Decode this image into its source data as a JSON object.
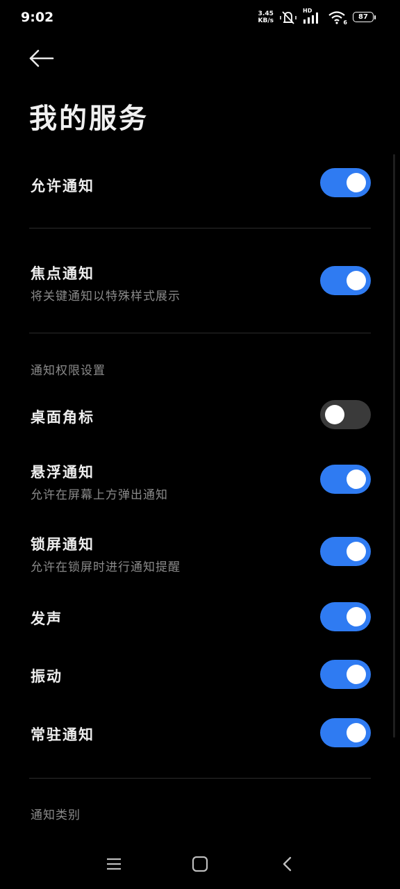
{
  "status_bar": {
    "time": "9:02",
    "net_speed_value": "3.45",
    "net_speed_unit": "KB/s",
    "network_type": "HD",
    "wifi_level": "6",
    "battery_level": "87"
  },
  "header": {
    "title": "我的服务"
  },
  "settings": {
    "allow_notifications": {
      "title": "允许通知",
      "enabled": true
    },
    "focus_notifications": {
      "title": "焦点通知",
      "subtitle": "将关键通知以特殊样式展示",
      "enabled": true
    }
  },
  "permissions": {
    "section_label": "通知权限设置",
    "items": [
      {
        "title": "桌面角标",
        "enabled": false
      },
      {
        "title": "悬浮通知",
        "subtitle": "允许在屏幕上方弹出通知",
        "enabled": true
      },
      {
        "title": "锁屏通知",
        "subtitle": "允许在锁屏时进行通知提醒",
        "enabled": true
      },
      {
        "title": "发声",
        "enabled": true
      },
      {
        "title": "振动",
        "enabled": true
      },
      {
        "title": "常驻通知",
        "enabled": true
      }
    ]
  },
  "categories": {
    "section_label": "通知类别"
  },
  "colors": {
    "accent": "#2f7bf2",
    "toggle_off": "#3a3a3a",
    "background": "#000000",
    "secondary_text": "#8a8a8a"
  },
  "icons": {
    "back": "arrow-left-icon",
    "menu": "menu-icon",
    "home": "home-icon",
    "nav_back": "chevron-left-icon"
  }
}
